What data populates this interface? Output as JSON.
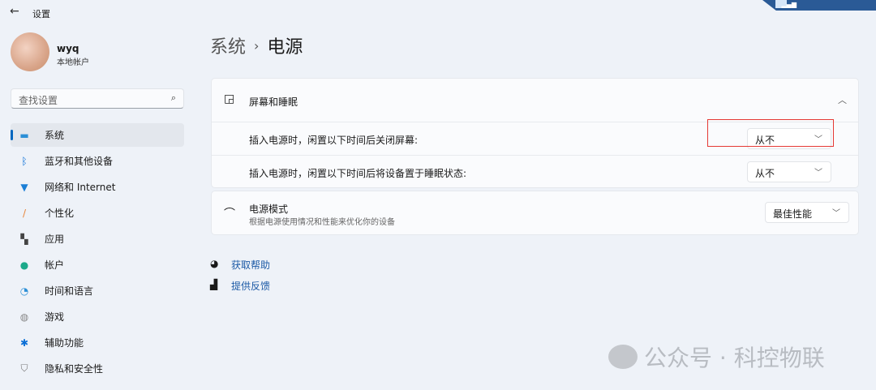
{
  "window": {
    "title": "设置",
    "back_icon": "back-arrow-icon"
  },
  "user": {
    "name": "wyq",
    "account_type": "本地帐户"
  },
  "search": {
    "placeholder": "查找设置"
  },
  "sidebar": {
    "items": [
      {
        "label": "系统",
        "icon": "system-icon",
        "active": true
      },
      {
        "label": "蓝牙和其他设备",
        "icon": "bluetooth-icon"
      },
      {
        "label": "网络和 Internet",
        "icon": "wifi-icon"
      },
      {
        "label": "个性化",
        "icon": "brush-icon"
      },
      {
        "label": "应用",
        "icon": "apps-icon"
      },
      {
        "label": "帐户",
        "icon": "account-icon"
      },
      {
        "label": "时间和语言",
        "icon": "time-language-icon"
      },
      {
        "label": "游戏",
        "icon": "gamepad-icon"
      },
      {
        "label": "辅助功能",
        "icon": "accessibility-icon"
      },
      {
        "label": "隐私和安全性",
        "icon": "shield-icon"
      }
    ]
  },
  "breadcrumb": {
    "parent": "系统",
    "sep": "›",
    "current": "电源"
  },
  "screen_sleep": {
    "title": "屏幕和睡眠",
    "screen_off": {
      "label": "插入电源时，闲置以下时间后关闭屏幕:",
      "value": "从不"
    },
    "sleep": {
      "label": "插入电源时，闲置以下时间后将设备置于睡眠状态:",
      "value": "从不"
    }
  },
  "power_mode": {
    "title": "电源模式",
    "description": "根据电源使用情况和性能来优化你的设备",
    "value": "最佳性能"
  },
  "links": {
    "help": "获取帮助",
    "feedback": "提供反馈"
  },
  "watermark": "公众号 · 科控物联"
}
